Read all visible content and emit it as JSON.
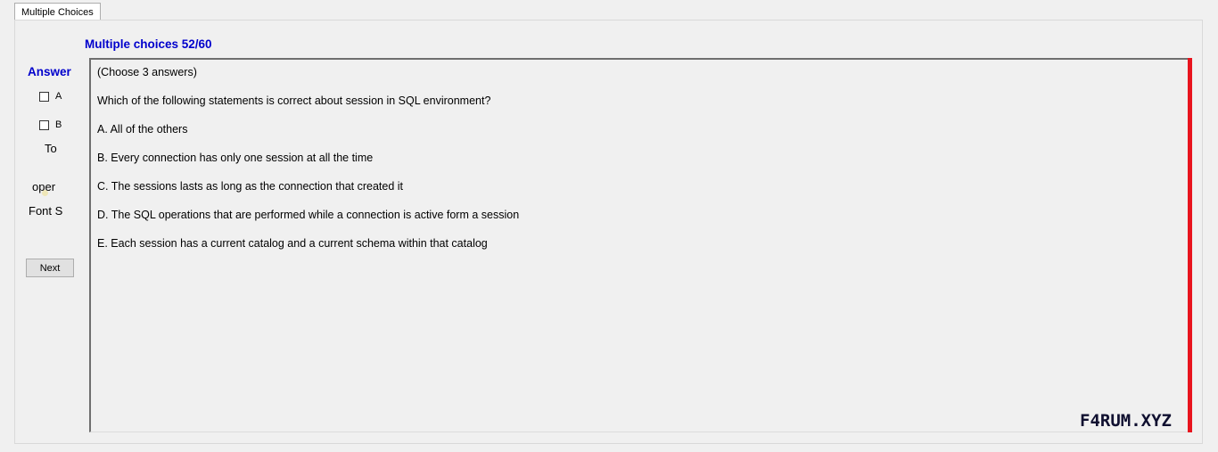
{
  "tabs": [
    {
      "label": "Multiple Choices"
    }
  ],
  "title": "Multiple choices 52/60",
  "answer": {
    "label": "Answer",
    "options": [
      {
        "label": "A",
        "checked": false
      },
      {
        "label": "B",
        "checked": false
      }
    ],
    "truncated_labels": [
      "To",
      "oper",
      "Font S"
    ]
  },
  "next_label": "Next",
  "question": {
    "instruction": "(Choose 3 answers)",
    "text": "Which of the following statements is correct about session in SQL environment?",
    "options": [
      "A.  All of the others",
      "B.  Every connection has only one session at all the time",
      "C.  The sessions lasts as long as the connection that created it",
      "D.  The SQL operations that are performed while a connection is active form a session",
      "E.  Each session has a current catalog and a current schema within that catalog"
    ]
  },
  "watermark": "F4RUM.XYZ",
  "colors": {
    "title": "#0000cc",
    "accent_bar": "#e8141e"
  }
}
